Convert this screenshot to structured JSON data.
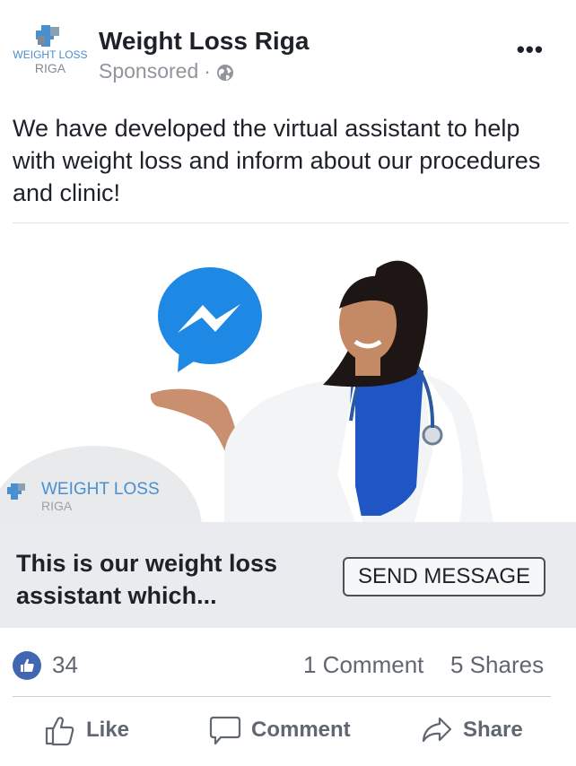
{
  "header": {
    "page_name": "Weight Loss Riga",
    "sponsored_label": "Sponsored",
    "separator": "·",
    "more_label": "•••",
    "logo_text_line1": "WEIGHT LOSS",
    "logo_text_line2": "RIGA"
  },
  "post": {
    "text": "We have developed the virtual assistant to help with weight loss and inform about our procedures and clinic!"
  },
  "media": {
    "watermark_line1": "WEIGHT LOSS",
    "watermark_line2": "RIGA"
  },
  "cta": {
    "headline": "This is our weight loss assistant which...",
    "button_label": "SEND MESSAGE"
  },
  "stats": {
    "likes": "34",
    "comments": "1 Comment",
    "shares": "5 Shares"
  },
  "actions": {
    "like": "Like",
    "comment": "Comment",
    "share": "Share"
  },
  "colors": {
    "brand_blue": "#4a8fd0",
    "messenger_blue": "#1e88e5",
    "like_blue": "#4267b2",
    "cta_bg": "#e9ebee"
  }
}
